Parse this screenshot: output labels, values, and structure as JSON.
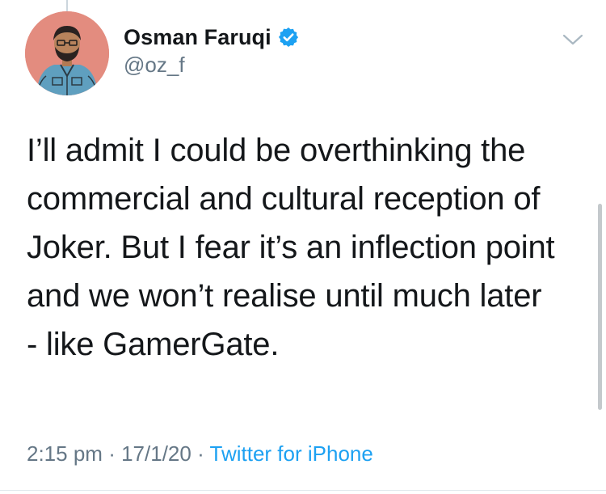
{
  "tweet": {
    "author": {
      "display_name": "Osman Faruqi",
      "handle": "@oz_f",
      "verified": true,
      "avatar_icon": "avatar-illustration"
    },
    "text": "I’ll admit I could be overthinking the\ncommercial and cultural reception of\nJoker. But I fear it’s an inflection point\nand we won’t realise until much later\n- like GamerGate.",
    "time": "2:15 pm",
    "separator": "·",
    "date": "17/1/20",
    "source": "Twitter for iPhone"
  },
  "colors": {
    "accent": "#1da1f2",
    "text": "#14171a",
    "muted": "#657786",
    "avatar_bg": "#e38c7f"
  },
  "icons": {
    "verified": "verified-badge-icon",
    "menu": "chevron-down-icon"
  }
}
